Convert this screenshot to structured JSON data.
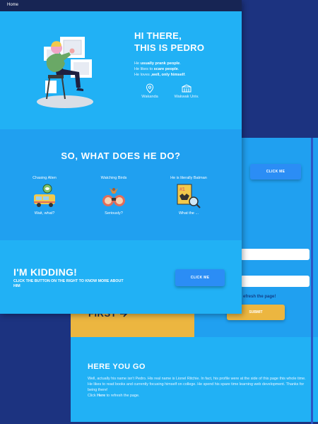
{
  "nav": {
    "home": "Home"
  },
  "hero": {
    "title_line1": "HI THERE,",
    "title_line2": "THIS IS PEDRO",
    "line1_pre": "He ",
    "line1_bold": "usually prank people",
    "line1_post": ".",
    "line2_pre": "He likes to ",
    "line2_bold": "scare people",
    "line2_post": ".",
    "line3_pre": "He loves ",
    "line3_bold": ",well, only himself",
    "line3_post": ".",
    "location": "Wakanda",
    "school": "Wakwak Univ."
  },
  "what": {
    "title": "SO, WHAT DOES HE DO?",
    "cards": [
      {
        "title": "Chasing Alien",
        "caption": "Wait, what?"
      },
      {
        "title": "Watching Birds",
        "caption": "Seriously?"
      },
      {
        "title": "He is literally Batman",
        "caption": "What the ..."
      }
    ]
  },
  "kidding": {
    "title": "I'M KIDDING!",
    "subtitle": "CLICK THE BUTTON ON THE RIGHT TO KNOW MORE ABOUT HIM",
    "button": "CLICK ME"
  },
  "back": {
    "click_button": "CLICK ME",
    "refresh_text": "efresh the page!",
    "submit_button": "SUBMIT",
    "first_text": "FIRST",
    "here_title": "HERE YOU GO",
    "here_text": "Well, actually his name isn't Pedro. His real name is Lionel Ritchie. In fact, his profile were at the side of this page this whole time. He likes to read books and currently focusing himself on college. He spend his spare time learning web development. Thanks for being there!",
    "here_click": "Click ",
    "here_link": "Here",
    "here_after": " to refresh the page."
  },
  "colors": {
    "navy": "#1c3380",
    "sky": "#21b1f5",
    "blue": "#20a0f0",
    "button": "#2b8df5",
    "yellow": "#ecb640"
  }
}
